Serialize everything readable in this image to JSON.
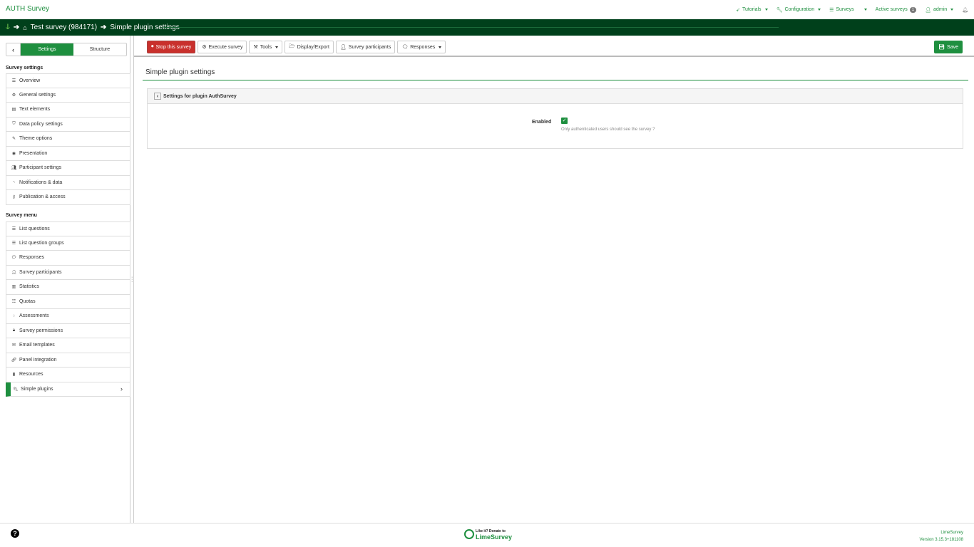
{
  "brand": "AUTH Survey",
  "topnav": {
    "tutorials": "Tutorials",
    "configuration": "Configuration",
    "surveys": "Surveys",
    "active_surveys": "Active surveys",
    "active_count": "1",
    "user": "admin"
  },
  "breadcrumb": {
    "home": "Test survey (984171)",
    "current": "Simple plugin settings"
  },
  "sidebar": {
    "tabs": [
      "Settings",
      "Structure"
    ],
    "settings_title": "Survey settings",
    "settings_items": [
      {
        "label": "Overview",
        "icon": "list-icon"
      },
      {
        "label": "General settings",
        "icon": "gears-icon"
      },
      {
        "label": "Text elements",
        "icon": "file-text-icon"
      },
      {
        "label": "Data policy settings",
        "icon": "shield-icon"
      },
      {
        "label": "Theme options",
        "icon": "paintbrush-icon"
      },
      {
        "label": "Presentation",
        "icon": "eye-slash-icon"
      },
      {
        "label": "Participant settings",
        "icon": "users-icon"
      },
      {
        "label": "Notifications & data",
        "icon": "feed-icon"
      },
      {
        "label": "Publication & access",
        "icon": "key-icon"
      }
    ],
    "menu_title": "Survey menu",
    "menu_items": [
      {
        "label": "List questions",
        "icon": "list-icon"
      },
      {
        "label": "List question groups",
        "icon": "list-icon"
      },
      {
        "label": "Responses",
        "icon": "comment-icon"
      },
      {
        "label": "Survey participants",
        "icon": "user-icon"
      },
      {
        "label": "Statistics",
        "icon": "bar-chart-icon"
      },
      {
        "label": "Quotas",
        "icon": "tasks-icon"
      },
      {
        "label": "Assessments",
        "icon": "comment-o-icon"
      },
      {
        "label": "Survey permissions",
        "icon": "lock-icon"
      },
      {
        "label": "Email templates",
        "icon": "envelope-icon"
      },
      {
        "label": "Panel integration",
        "icon": "link-icon"
      },
      {
        "label": "Resources",
        "icon": "file-icon"
      },
      {
        "label": "Simple plugins",
        "icon": "plug-icon"
      }
    ]
  },
  "toolbar": {
    "stop": "Stop this survey",
    "execute": "Execute survey",
    "tools": "Tools",
    "display_export": "Display/Export",
    "participants": "Survey participants",
    "responses": "Responses",
    "save": "Save"
  },
  "main": {
    "title": "Simple plugin settings",
    "panel_title": "Settings for plugin AuthSurvey",
    "field_label": "Enabled",
    "field_checked": true,
    "field_help": "Only authenticated users should see the survey ?"
  },
  "footer": {
    "donate_small": "Like it? Donate to",
    "donate_big": "LimeSurvey",
    "app_name": "LimeSurvey",
    "version": "Version 3.15.3+181108"
  },
  "colors": {
    "accent": "#1e8f3f",
    "breadcrumb_bg": "#00401b",
    "danger": "#c9302c"
  }
}
